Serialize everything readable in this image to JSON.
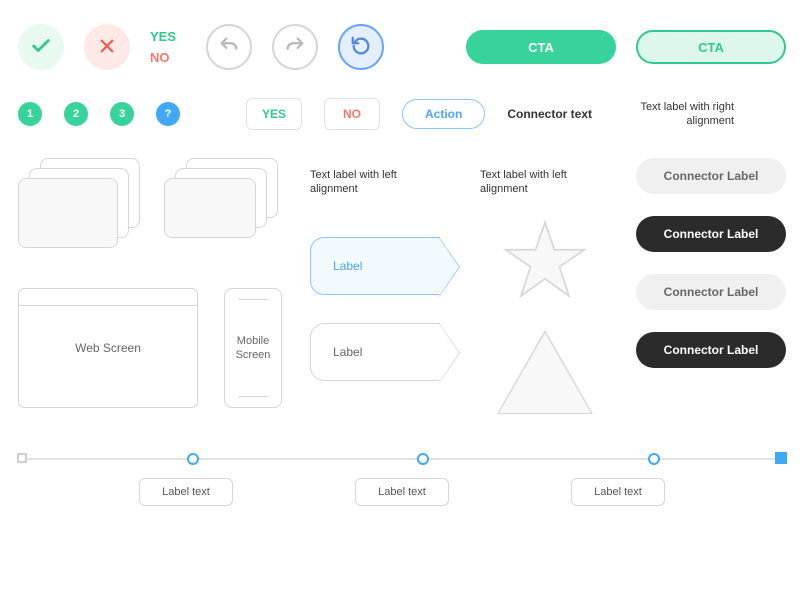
{
  "row1": {
    "yes": "YES",
    "no": "NO",
    "cta_solid": "CTA",
    "cta_outline": "CTA"
  },
  "row2": {
    "step1": "1",
    "step2": "2",
    "step3": "3",
    "help": "?",
    "yes": "YES",
    "no": "NO",
    "action": "Action",
    "connector_text": "Connector text",
    "right_label": "Text label with right alignment"
  },
  "mid": {
    "text_left_1": "Text label with left alignment",
    "text_left_2": "Text label with left alignment",
    "web_screen": "Web Screen",
    "mobile_screen": "Mobile Screen",
    "tag_blue": "Label",
    "tag_gray": "Label",
    "connectors": [
      "Connector Label",
      "Connector Label",
      "Connector Label",
      "Connector Label"
    ]
  },
  "slider": {
    "label1": "Label text",
    "label2": "Label text",
    "label3": "Label text"
  }
}
